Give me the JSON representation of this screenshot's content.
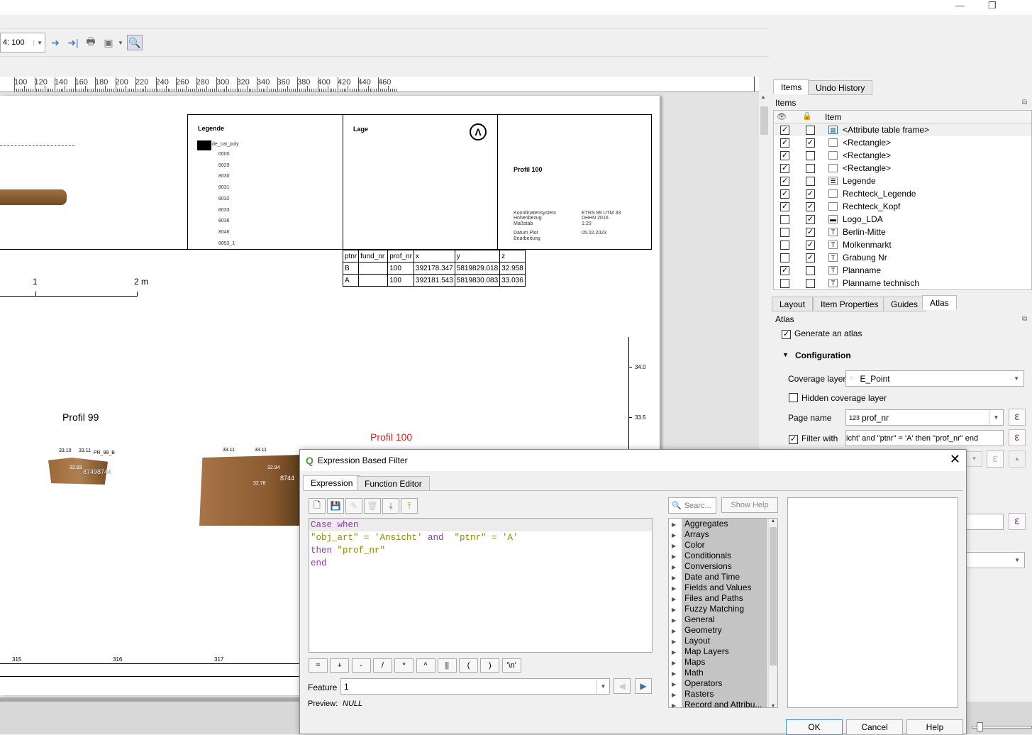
{
  "window": {
    "minimize": "—",
    "restore": "❐"
  },
  "toolbar": {
    "atlas_page": "4: 100"
  },
  "ruler": {
    "labels": [
      "100",
      "120",
      "140",
      "160",
      "180",
      "200",
      "220",
      "240",
      "260",
      "280",
      "300",
      "320",
      "340",
      "360",
      "380",
      "400",
      "420",
      "440",
      "460"
    ]
  },
  "layout": {
    "legend_title": "Legende",
    "legend_layer": "de_cat_poly",
    "legend_items": [
      "0000",
      "8029",
      "8030",
      "8031",
      "8032",
      "8033",
      "8036",
      "8046",
      "8053_1"
    ],
    "lage_title": "Lage",
    "profile_title": "Profil 100",
    "meta_labels": [
      "Koordinatensystem",
      "Höhenbezug",
      "Maßstab",
      "Datum Plot",
      "Bearbeitung"
    ],
    "meta_values": [
      "ETRS 89 UTM 33",
      "DHHN 2016",
      "1:20",
      "05.02.2023",
      ""
    ],
    "scale_labels": [
      "1",
      "2 m"
    ],
    "table": {
      "headers": [
        "ptnr",
        "fund_nr",
        "prof_nr",
        "x",
        "y",
        "z"
      ],
      "rows": [
        [
          "B",
          "",
          "100",
          "392178.347",
          "5819829.018",
          "32.958"
        ],
        [
          "A",
          "",
          "100",
          "392181.543",
          "5819830.083",
          "33.036"
        ]
      ]
    },
    "vaxis": [
      "34.0",
      "33.5"
    ],
    "profil99": "Profil 99",
    "profil100_label": "Profil 100",
    "p99_labels": [
      "33.10",
      "33.11",
      "PR_99_B",
      "32.93",
      "87498744"
    ],
    "p100_labels": [
      "33.11",
      "33.11",
      "32.94",
      "8744",
      "32.78"
    ],
    "xaxis": [
      "315",
      "316",
      "317"
    ],
    "accent_red": "#e02020"
  },
  "items_panel": {
    "tabs": [
      "Items",
      "Undo History"
    ],
    "title": "Items",
    "col_item": "Item",
    "rows": [
      {
        "label": "<Attribute table frame>",
        "visible": true,
        "locked": false,
        "icon": "table-icon"
      },
      {
        "label": "<Rectangle>",
        "visible": true,
        "locked": true,
        "icon": "rect-icon"
      },
      {
        "label": "<Rectangle>",
        "visible": true,
        "locked": false,
        "icon": "rect-icon"
      },
      {
        "label": "<Rectangle>",
        "visible": true,
        "locked": false,
        "icon": "rect-icon"
      },
      {
        "label": "Legende",
        "visible": true,
        "locked": false,
        "icon": "legend-icon"
      },
      {
        "label": "Rechteck_Legende",
        "visible": true,
        "locked": true,
        "icon": "rect-icon"
      },
      {
        "label": "Rechteck_Kopf",
        "visible": true,
        "locked": true,
        "icon": "rect-icon"
      },
      {
        "label": "Logo_LDA",
        "visible": false,
        "locked": true,
        "icon": "picture-icon"
      },
      {
        "label": "Berlin-Mitte",
        "visible": false,
        "locked": true,
        "icon": "text-icon"
      },
      {
        "label": "Molkenmarkt",
        "visible": false,
        "locked": true,
        "icon": "text-icon"
      },
      {
        "label": "Grabung Nr",
        "visible": false,
        "locked": true,
        "icon": "text-icon"
      },
      {
        "label": "Planname",
        "visible": true,
        "locked": false,
        "icon": "text-icon"
      },
      {
        "label": "Planname technisch",
        "visible": false,
        "locked": false,
        "icon": "text-icon"
      }
    ]
  },
  "atlas_panel": {
    "tabs": [
      "Layout",
      "Item Properties",
      "Guides",
      "Atlas"
    ],
    "title": "Atlas",
    "generate": "Generate an atlas",
    "generate_checked": true,
    "configuration": "Configuration",
    "coverage_label": "Coverage layer",
    "coverage_value": "E_Point",
    "hidden_label": "Hidden coverage layer",
    "hidden_checked": false,
    "page_name_label": "Page name",
    "page_name_prefix": "123",
    "page_name_value": "prof_nr",
    "filter_label": "Filter with",
    "filter_checked": true,
    "filter_value": "icht' and  \"ptnr\" = 'A'   then \"prof_nr\"   end"
  },
  "dialog": {
    "title": "Expression Based Filter",
    "tabs": [
      "Expression",
      "Function Editor"
    ],
    "code": [
      [
        {
          "t": "Case when",
          "c": "kw"
        }
      ],
      [
        {
          "t": "\"obj_art\" = 'Ansicht' ",
          "c": "st"
        },
        {
          "t": "and",
          "c": "kw"
        },
        {
          "t": "  \"ptnr\" = 'A'",
          "c": "st"
        }
      ],
      [
        {
          "t": "then ",
          "c": "kw"
        },
        {
          "t": "\"prof_nr\"",
          "c": "st"
        }
      ],
      [
        {
          "t": "end",
          "c": "kw"
        }
      ]
    ],
    "operators": [
      "=",
      "+",
      "-",
      "/",
      "*",
      "^",
      "||",
      "(",
      ")",
      "'\\n'"
    ],
    "feature_label": "Feature",
    "feature_value": "1",
    "preview_label": "Preview:",
    "preview_value": "NULL",
    "search_placeholder": "Searc...",
    "show_help": "Show Help",
    "groups": [
      "Aggregates",
      "Arrays",
      "Color",
      "Conditionals",
      "Conversions",
      "Date and Time",
      "Fields and Values",
      "Files and Paths",
      "Fuzzy Matching",
      "General",
      "Geometry",
      "Layout",
      "Map Layers",
      "Maps",
      "Math",
      "Operators",
      "Rasters",
      "Record and Attribu..."
    ],
    "ok": "OK",
    "cancel": "Cancel",
    "help": "Help"
  }
}
